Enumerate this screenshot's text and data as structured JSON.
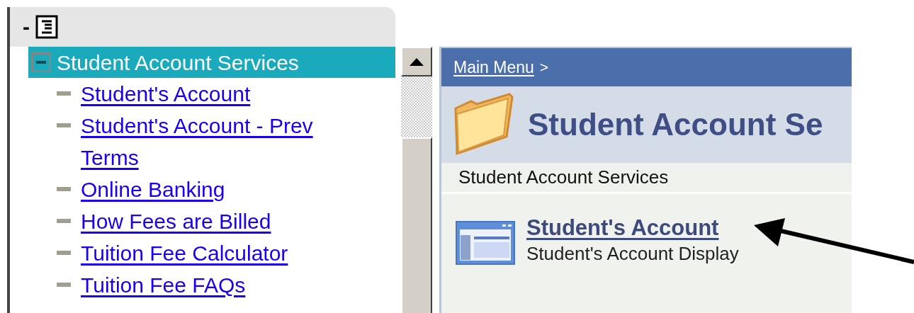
{
  "menu_header": {
    "collapse_glyph": "-"
  },
  "tree": {
    "label": "Student Account Services",
    "expanded": true,
    "selected": true,
    "children": [
      {
        "label": "Student's Account"
      },
      {
        "label": "Student's Account - Prev Terms"
      },
      {
        "label": "Online Banking"
      },
      {
        "label": "How Fees are Billed"
      },
      {
        "label": "Tuition Fee Calculator"
      },
      {
        "label": "Tuition Fee FAQs"
      }
    ]
  },
  "content": {
    "breadcrumb": [
      {
        "label": "Main Menu"
      }
    ],
    "breadcrumb_separator": ">",
    "title": "Student Account Se",
    "section": "Student Account Services",
    "items": [
      {
        "title": "Student's Account",
        "description": "Student's Account Display"
      }
    ]
  }
}
